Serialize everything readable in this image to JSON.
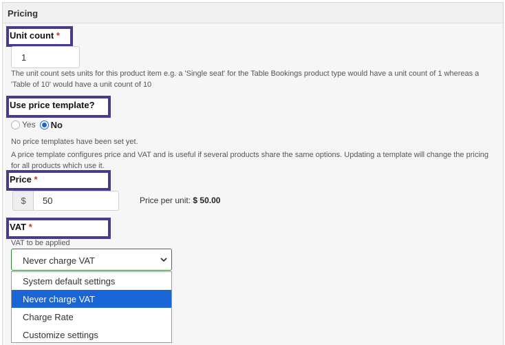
{
  "section": {
    "title": "Pricing"
  },
  "unit_count": {
    "label": "Unit count",
    "required_mark": "*",
    "value": "1",
    "help": "The unit count sets units for this product item e.g. a 'Single seat' for the Table Bookings product type would have a unit count of 1 whereas a 'Table of 10' would have a unit count of 10"
  },
  "price_template": {
    "label": "Use price template?",
    "options": [
      {
        "label": "Yes",
        "checked": false
      },
      {
        "label": "No",
        "checked": true
      }
    ],
    "note": "No price templates have been set yet.",
    "help": "A price template configures price and VAT and is useful if several products share the same options. Updating a template will change the pricing for all products which use it."
  },
  "price": {
    "label": "Price",
    "required_mark": "*",
    "currency_symbol": "$",
    "value": "50",
    "per_unit_label": "Price per unit:",
    "per_unit_value": "$ 50.00"
  },
  "vat": {
    "label": "VAT",
    "required_mark": "*",
    "help": "VAT to be applied",
    "selected": "Never charge VAT",
    "options": [
      {
        "label": "System default settings",
        "selected": false
      },
      {
        "label": "Never charge VAT",
        "selected": true
      },
      {
        "label": "Charge Rate",
        "selected": false
      },
      {
        "label": "Customize settings",
        "selected": false
      }
    ]
  },
  "colors": {
    "highlight_border": "#4b3a8c",
    "required": "#c0392b",
    "accent": "#1a66d6",
    "select_border": "#2e7d32"
  }
}
